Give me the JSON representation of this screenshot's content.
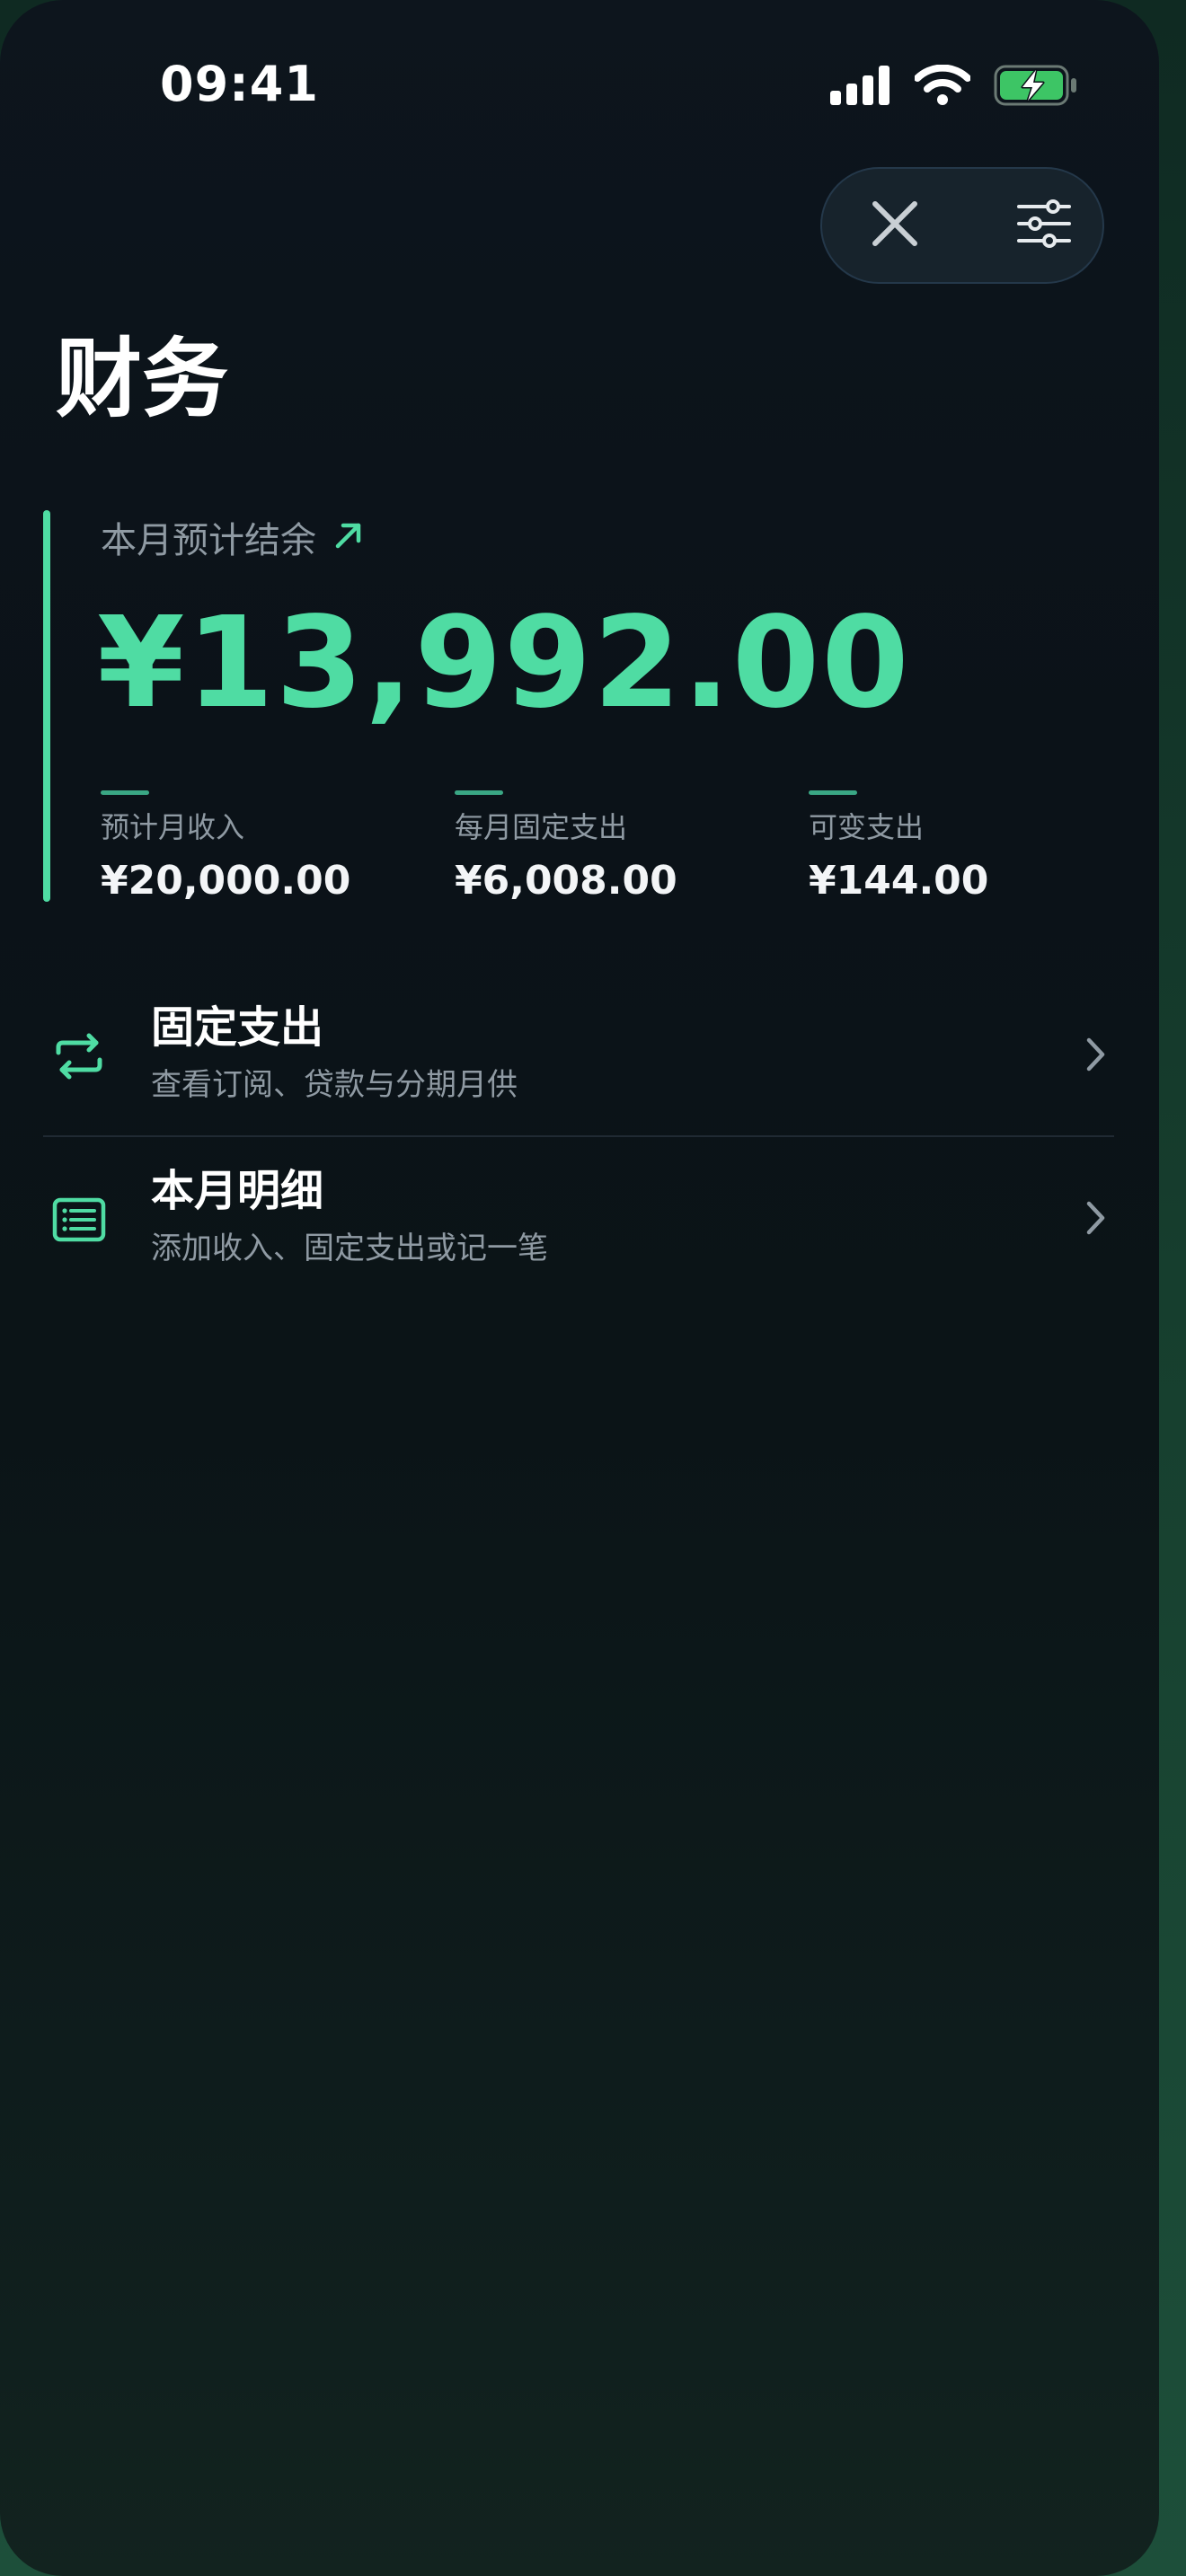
{
  "status_bar": {
    "time": "09:41",
    "icons": [
      "cellular-signal-icon",
      "wifi-icon",
      "battery-charging-icon"
    ]
  },
  "toolbar": {
    "close_icon": "close-icon",
    "filter_icon": "sliders-icon"
  },
  "page": {
    "title": "财务"
  },
  "summary": {
    "label": "本月预计结余",
    "trend_icon": "arrow-up-right-icon",
    "amount": "¥13,992.00",
    "stats": [
      {
        "label": "预计月收入",
        "value": "¥20,000.00"
      },
      {
        "label": "每月固定支出",
        "value": "¥6,008.00"
      },
      {
        "label": "可变支出",
        "value": "¥144.00"
      }
    ]
  },
  "menu": {
    "items": [
      {
        "icon": "repeat-icon",
        "title": "固定支出",
        "subtitle": "查看订阅、贷款与分期月供"
      },
      {
        "icon": "list-icon",
        "title": "本月明细",
        "subtitle": "添加收入、固定支出或记一笔"
      }
    ]
  },
  "colors": {
    "accent": "#4fdca3",
    "background": "#0b1218",
    "text_primary": "#ffffff",
    "text_secondary": "#8f9aa3"
  }
}
